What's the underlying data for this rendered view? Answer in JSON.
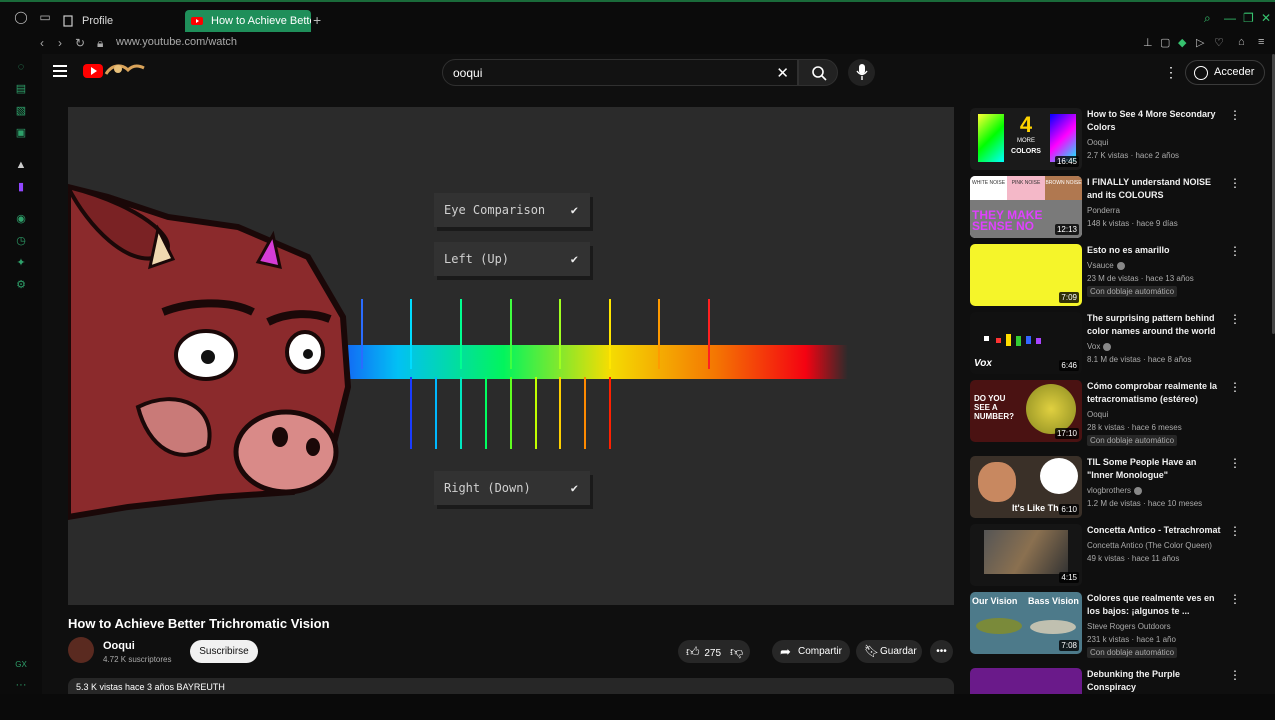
{
  "browser": {
    "tabs": [
      {
        "label": "Profile"
      },
      {
        "label": "How to Achieve Bette"
      }
    ],
    "url": "www.youtube.com/watch",
    "accent": "#1f8f5a"
  },
  "header": {
    "search_value": "ooqui",
    "signin_label": "Acceder"
  },
  "player": {
    "labels": [
      "Eye Comparison",
      "Left (Up)",
      "Right (Down)"
    ]
  },
  "video": {
    "title": "How to Achieve Better Trichromatic Vision",
    "channel": "Ooqui",
    "subscribers": "4.72 K suscriptores",
    "subscribe_label": "Suscribirse",
    "likes": "275",
    "share_label": "Compartir",
    "save_label": "Guardar",
    "description_preview": "5.3 K vistas  hace 3 años  BAYREUTH"
  },
  "recommendations": [
    {
      "title": "How  to See 4 More Secondary Colors",
      "channel": "Ooqui",
      "meta": "2.7 K vistas · hace 2 años",
      "duration": "16:45",
      "verified": false,
      "dubbed": ""
    },
    {
      "title": "I FINALLY understand NOISE and its COLOURS",
      "channel": "Ponderra",
      "meta": "148 k vistas · hace 9 días",
      "duration": "12:13",
      "verified": false,
      "dubbed": ""
    },
    {
      "title": "Esto no es amarillo",
      "channel": "Vsauce",
      "meta": "23 M de vistas · hace 13 años",
      "duration": "7:09",
      "verified": true,
      "dubbed": "Con doblaje automático"
    },
    {
      "title": "The surprising pattern behind color names around the world",
      "channel": "Vox",
      "meta": "8.1 M de vistas · hace 8 años",
      "duration": "6:46",
      "verified": true,
      "dubbed": ""
    },
    {
      "title": "Cómo comprobar realmente la tetracromatismo (estéreo)",
      "channel": "Ooqui",
      "meta": "28 k vistas · hace 6 meses",
      "duration": "17:10",
      "verified": false,
      "dubbed": "Con doblaje automático"
    },
    {
      "title": "TIL Some People Have an \"Inner Monologue\"",
      "channel": "vlogbrothers",
      "meta": "1.2 M de vistas · hace 10 meses",
      "duration": "6:10",
      "verified": true,
      "dubbed": ""
    },
    {
      "title": "Concetta Antico - Tetrachromat",
      "channel": "Concetta Antico (The Color Queen)",
      "meta": "49 k vistas · hace 11 años",
      "duration": "4:15",
      "verified": false,
      "dubbed": ""
    },
    {
      "title": "Colores que realmente ves en los bajos: ¡algunos te ...",
      "channel": "Steve Rogers Outdoors",
      "meta": "231 k vistas · hace 1 año",
      "duration": "7:08",
      "verified": false,
      "dubbed": "Con doblaje automático"
    },
    {
      "title": "Debunking the Purple Conspiracy",
      "channel": "",
      "meta": "",
      "duration": "",
      "verified": false,
      "dubbed": ""
    }
  ],
  "thumb_text": {
    "t1": [
      "4",
      "MORE",
      "COLORS"
    ],
    "t2": [
      "WHITE NOISE",
      "PINK NOISE",
      "BROWN NOISE",
      "THEY MAKE SENSE NO"
    ],
    "t4": "Vox",
    "t5": [
      "DO YOU SEE A NUMBER?"
    ],
    "t6": "It's Like Th",
    "t8": [
      "Our Vision",
      "Bass Vision"
    ]
  }
}
